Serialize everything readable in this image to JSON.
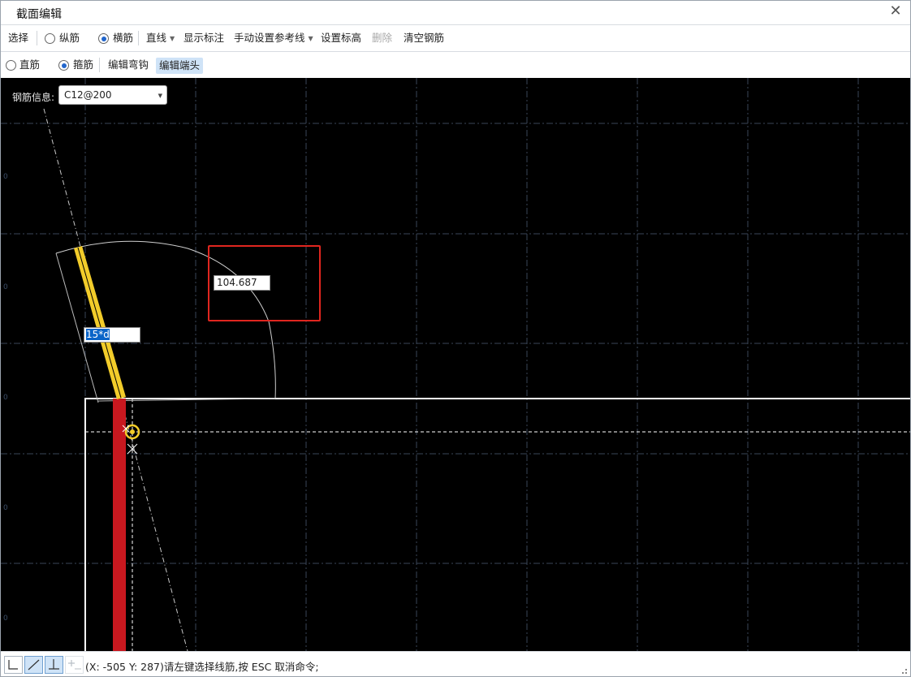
{
  "window": {
    "title": "截面编辑",
    "close_glyph": "✕"
  },
  "toolbar1": {
    "select": "选择",
    "longitudinal": "纵筋",
    "transverse": "横筋",
    "line_mode": "直线",
    "show_dimensions": "显示标注",
    "manual_reference": "手动设置参考线",
    "set_elevation": "设置标高",
    "delete": "删除",
    "clear_rebar": "清空钢筋"
  },
  "toolbar2": {
    "straight_bar": "直筋",
    "stirrup": "箍筋",
    "edit_hook": "编辑弯钩",
    "edit_end": "编辑端头"
  },
  "canvas": {
    "rebar_info_label": "钢筋信息:",
    "rebar_info_value": "C12@200",
    "length_value": "104.687",
    "hook_value": "15*d",
    "y_tick_labels": [
      "0",
      "0",
      "0",
      "0",
      "0",
      "0"
    ]
  },
  "status": {
    "message": "(X: -505 Y: 287)请左键选择线筋,按 ESC 取消命令;"
  },
  "colors": {
    "canvas_bg": "#000000",
    "rebar_yellow": "#f2cc2a",
    "rebar_red": "#c8181f",
    "highlight_red": "#e0261f",
    "selection_blue": "#0a64c8",
    "active_tab_bg": "#cfe3f7"
  },
  "icons": [
    "close-icon",
    "radio-icon",
    "dropdown-caret-icon",
    "ortho-snap-icon",
    "line-tool-icon",
    "perpendicular-icon",
    "add-point-icon",
    "resize-grip-icon"
  ]
}
